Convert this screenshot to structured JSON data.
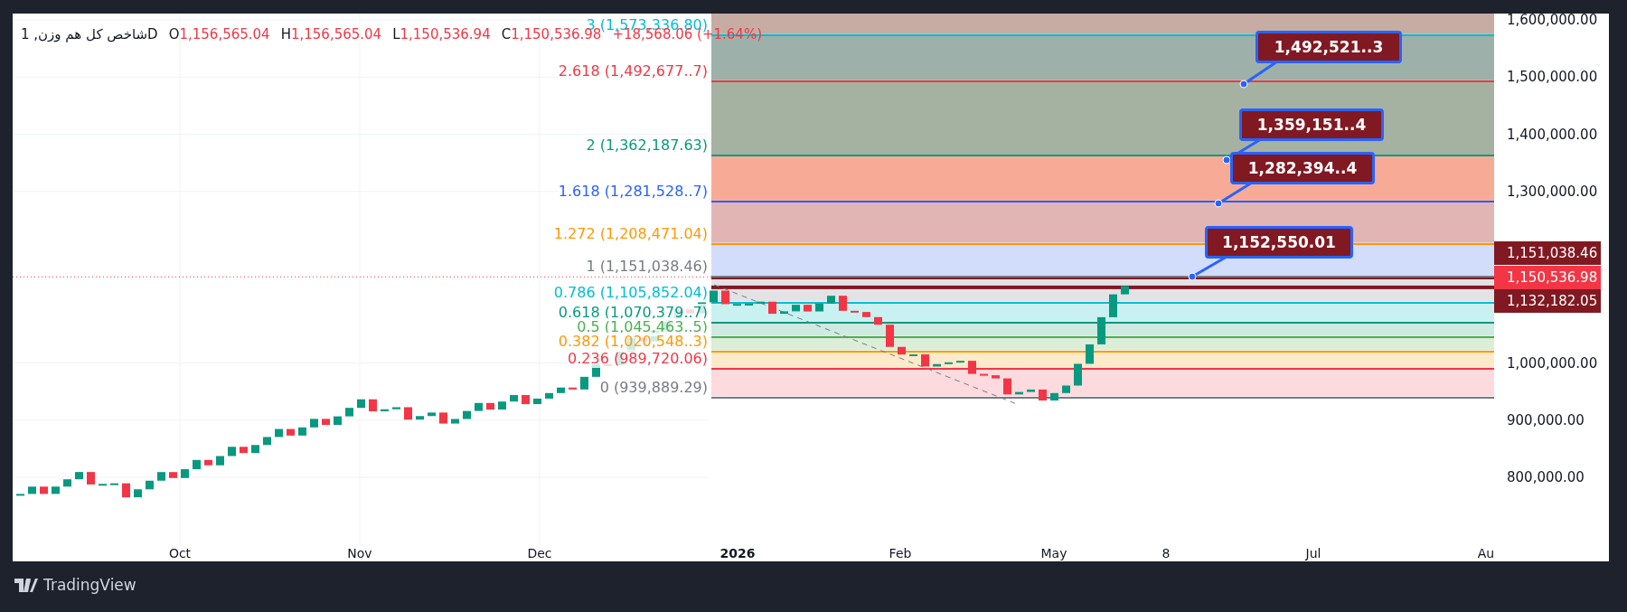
{
  "legend": {
    "symbol": "شاخص کل هم وزن, 1D",
    "ohlc": [
      {
        "key": "O",
        "value": "1,156,565.04"
      },
      {
        "key": "H",
        "value": "1,156,565.04"
      },
      {
        "key": "L",
        "value": "1,150,536.94"
      },
      {
        "key": "C",
        "value": "1,150,536.98"
      }
    ],
    "change": "+18,568.06 (+1.64%)"
  },
  "fib_levels": [
    {
      "label": "3 (1,573,336.80)",
      "color": "#00bcd4"
    },
    {
      "label": "2.618 (1,492,677..7)",
      "color": "#f23645"
    },
    {
      "label": "2 (1,362,187.63)",
      "color": "#089981"
    },
    {
      "label": "1.618 (1,281,528..7)",
      "color": "#2962ff"
    },
    {
      "label": "1.272 (1,208,471.04)",
      "color": "#ff9800"
    },
    {
      "label": "1 (1,151,038.46)",
      "color": "#787b86"
    },
    {
      "label": "0.786 (1,105,852.04)",
      "color": "#00bcd4"
    },
    {
      "label": "0.618 (1,070,379..7)",
      "color": "#089981"
    },
    {
      "label": "0.5 (1,045,463..5)",
      "color": "#4caf50"
    },
    {
      "label": "0.382 (1,020,548..3)",
      "color": "#ff9800"
    },
    {
      "label": "0.236 (989,720.06)",
      "color": "#f23645"
    },
    {
      "label": "0 (939,889.29)",
      "color": "#787b86"
    }
  ],
  "callouts": [
    {
      "text": "1,492,521..3"
    },
    {
      "text": "1,359,151..4"
    },
    {
      "text": "1,282,394..4"
    },
    {
      "text": "1,152,550.01"
    }
  ],
  "price_axis": {
    "ticks": [
      "1,600,000.00",
      "1,500,000.00",
      "1,400,000.00",
      "1,300,000.00",
      "1,000,000.00",
      "900,000.00",
      "800,000.00"
    ],
    "tags": [
      {
        "text": "1,151,038.46",
        "color": "#801922"
      },
      {
        "text": "1,150,536.98",
        "color": "#f23645"
      },
      {
        "text": "1,132,182.05",
        "color": "#801922"
      }
    ]
  },
  "time_axis": [
    {
      "label": "Oct",
      "bold": false
    },
    {
      "label": "Nov",
      "bold": false
    },
    {
      "label": "Dec",
      "bold": false
    },
    {
      "label": "2026",
      "bold": true
    },
    {
      "label": "Feb",
      "bold": false
    },
    {
      "label": "May",
      "bold": false
    },
    {
      "label": "8",
      "bold": false
    },
    {
      "label": "Jul",
      "bold": false
    },
    {
      "label": "Au",
      "bold": false
    }
  ],
  "footer": {
    "brand": "TradingView"
  }
}
